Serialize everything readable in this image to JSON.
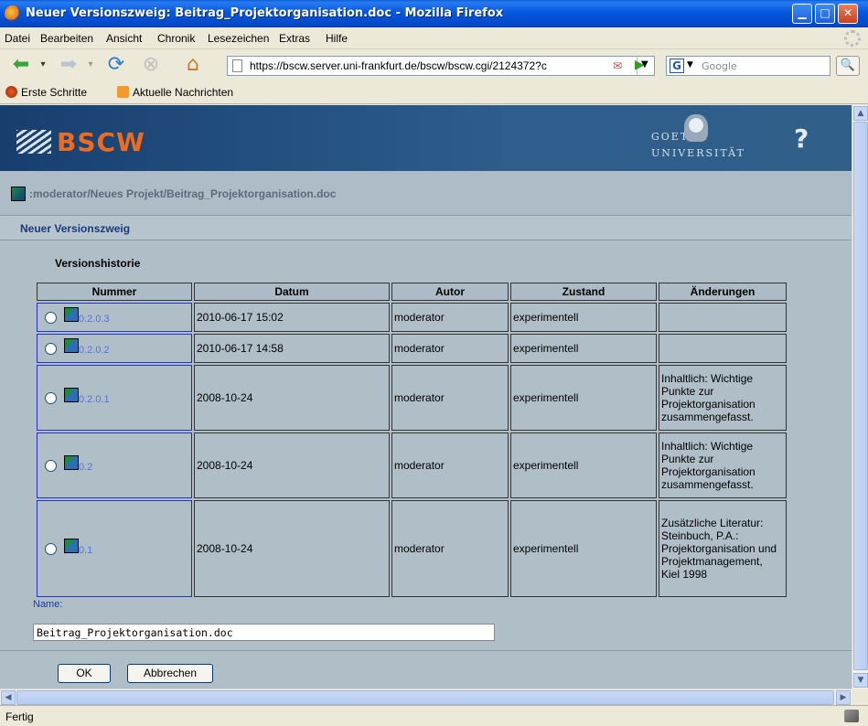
{
  "window": {
    "title": "Neuer Versionszweig: Beitrag_Projektorganisation.doc - Mozilla Firefox"
  },
  "menu": [
    "Datei",
    "Bearbeiten",
    "Ansicht",
    "Chronik",
    "Lesezeichen",
    "Extras",
    "Hilfe"
  ],
  "nav": {
    "url": "https://bscw.server.uni-frankfurt.de/bscw/bscw.cgi/2124372?c",
    "search_placeholder": "Google",
    "search_engine": "G"
  },
  "bookmarks": [
    "Erste Schritte",
    "Aktuelle Nachrichten"
  ],
  "page": {
    "logo": "BSCW",
    "univ_line1": "GOETHE",
    "univ_line2": "UNIVERSITÄT",
    "help": "?",
    "breadcrumb": ":moderator/Neues Projekt/Beitrag_Projektorganisation.doc",
    "section_title": "Neuer Versionszweig",
    "history_title": "Versionshistorie",
    "columns": [
      "Nummer",
      "Datum",
      "Autor",
      "Zustand",
      "Änderungen"
    ],
    "rows": [
      {
        "nummer": "0.2.0.3",
        "datum": "2010-06-17 15:02",
        "autor": "moderator",
        "zustand": "experimentell",
        "aenderungen": ""
      },
      {
        "nummer": "0.2.0.2",
        "datum": "2010-06-17 14:58",
        "autor": "moderator",
        "zustand": "experimentell",
        "aenderungen": ""
      },
      {
        "nummer": "0.2.0.1",
        "datum": "2008-10-24",
        "autor": "moderator",
        "zustand": "experimentell",
        "aenderungen": "Inhaltlich: Wichtige Punkte zur Projektorganisation zusammengefasst."
      },
      {
        "nummer": "0.2",
        "datum": "2008-10-24",
        "autor": "moderator",
        "zustand": "experimentell",
        "aenderungen": "Inhaltlich: Wichtige Punkte zur Projektorganisation zusammengefasst."
      },
      {
        "nummer": "0.1",
        "datum": "2008-10-24",
        "autor": "moderator",
        "zustand": "experimentell",
        "aenderungen": "Zusätzliche Literatur: Steinbuch, P.A.: Projektorganisation und Projektmanagement, Kiel 1998"
      }
    ],
    "name_label": "Name:",
    "name_value": "Beitrag_Projektorganisation.doc",
    "ok_label": "OK",
    "cancel_label": "Abbrechen"
  },
  "status": "Fertig"
}
